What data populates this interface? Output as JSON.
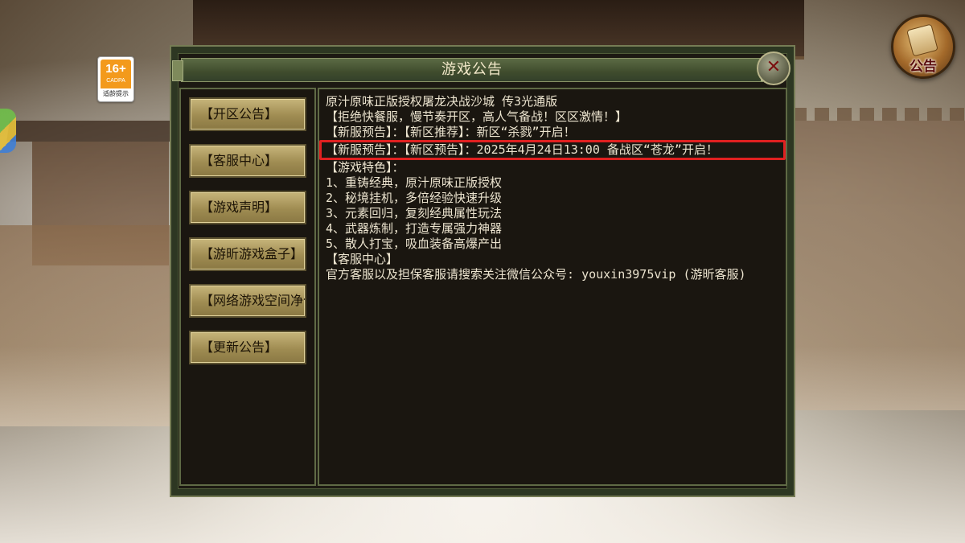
{
  "age_badge": {
    "rating": "16+",
    "org": "CADPA",
    "tip": "适龄提示"
  },
  "notice_button": {
    "label": "公告"
  },
  "panel": {
    "title": "游戏公告",
    "close_symbol": "✕",
    "sidebar": [
      {
        "label": "【开区公告】"
      },
      {
        "label": "【客服中心】"
      },
      {
        "label": "【游戏声明】"
      },
      {
        "label": "【游昕游戏盒子】"
      },
      {
        "label": "【网络游戏空间净化"
      },
      {
        "label": "【更新公告】"
      }
    ],
    "content": {
      "lines": [
        "原汁原味正版授权屠龙决战沙城 传3光通版",
        "【拒绝快餐服，慢节奏开区，高人气备战！区区激情！】",
        "【新服预告】：【新区推荐】：新区“杀戮”开启！"
      ],
      "highlighted": "【新服预告】：【新区预告】：2025年4月24日13:00 备战区“苍龙”开启！",
      "features_header": "【游戏特色】：",
      "features": [
        "1、重铸经典，原汁原味正版授权",
        "2、秘境挂机，多倍经验快速升级",
        "3、元素回归，复刻经典属性玩法",
        "4、武器炼制，打造专属强力神器",
        "5、散人打宝，吸血装备高爆产出"
      ],
      "service_header": "【客服中心】",
      "service_text": "官方客服以及担保客服请搜索关注微信公众号: youxin3975vip (游昕客服)"
    }
  },
  "colors": {
    "highlight_border": "#e02020",
    "panel_bg": "#1c1912",
    "button_gold": "#b4a265"
  }
}
